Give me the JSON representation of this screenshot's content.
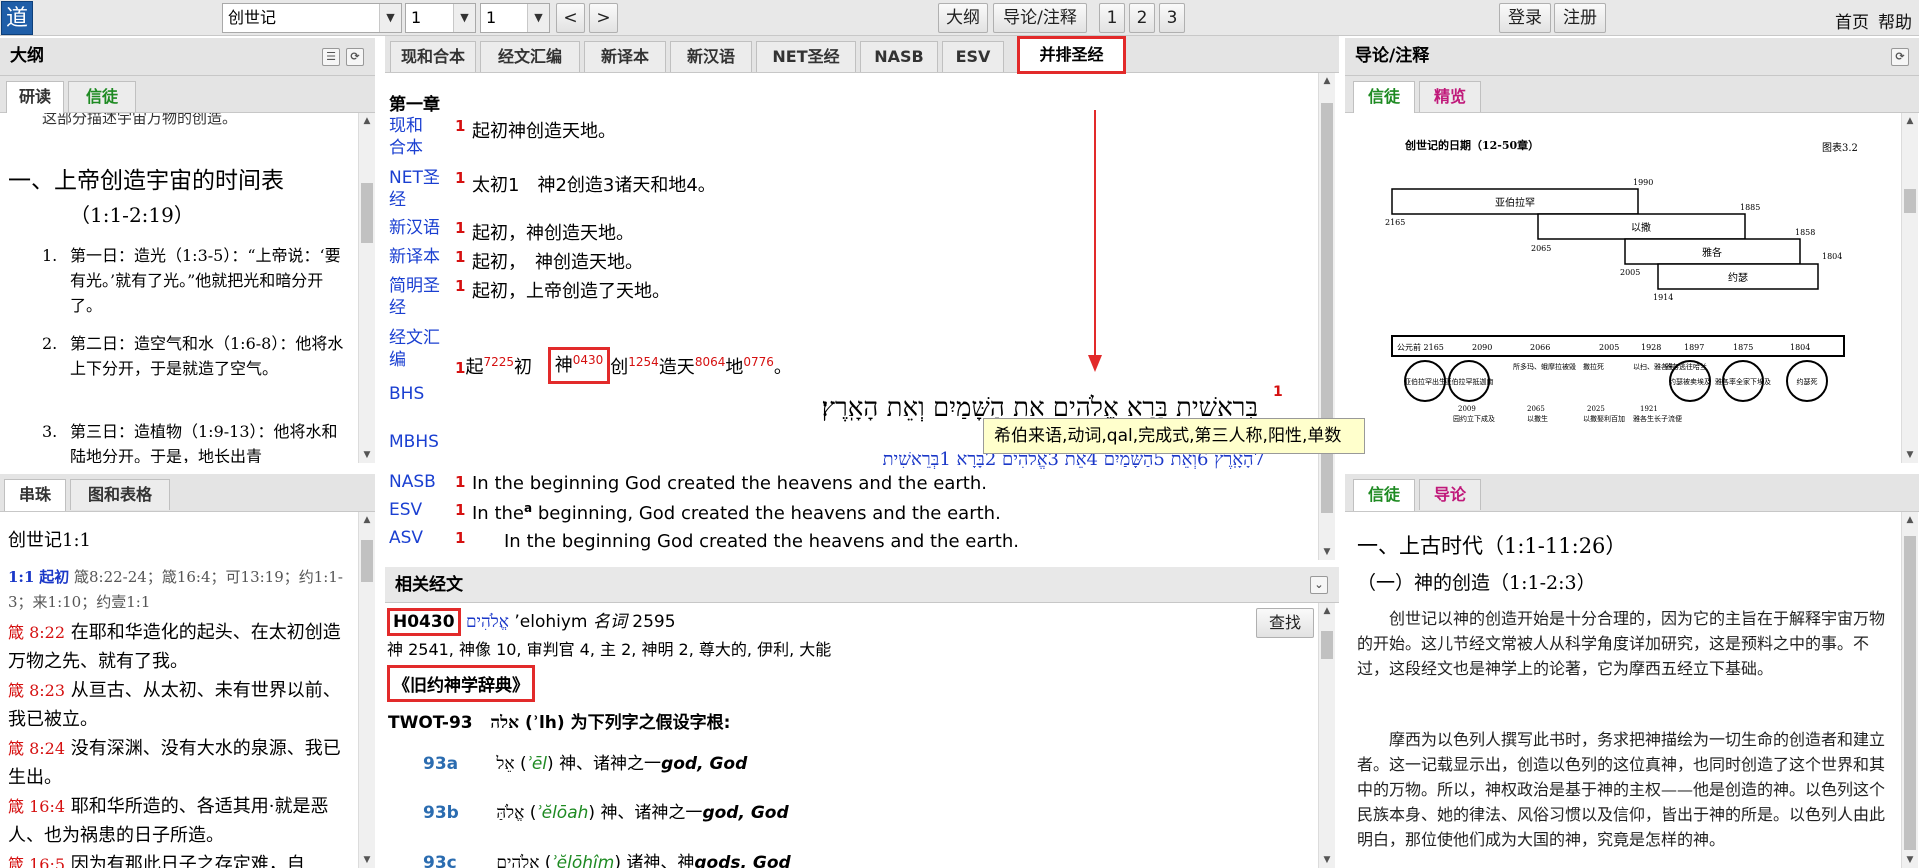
{
  "topbar": {
    "logo": "道",
    "book": "创世记",
    "chapter": "1",
    "verse": "1",
    "prev": "<",
    "next": ">",
    "outline_btn": "大纲",
    "intro_btn": "导论/注释",
    "layout1": "1",
    "layout2": "2",
    "layout3": "3",
    "login": "登录",
    "register": "注册",
    "home": "首页",
    "help": "帮助"
  },
  "left_top": {
    "title": "大纲",
    "tab_study": "研读",
    "tab_xinjing": "信徒",
    "cut_text": "这部分描述宇宙万物的创造。",
    "heading": "一、上帝创造宇宙的时间表",
    "heading_ref": "（1:1-2:19）",
    "items": [
      {
        "num": "1.",
        "text": "第一日：造光（1:3-5）：“上帝说：‘要有光。’就有了光。”他就把光和暗分开了。"
      },
      {
        "num": "2.",
        "text": "第二日：造空气和水（1:6-8）：他将水上下分开，于是就造了空气。"
      },
      {
        "num": "3.",
        "text": "第三日：造植物（1:9-13）：他将水和陆地分开。于是，地长出青"
      }
    ]
  },
  "left_bottom": {
    "tab_chain": "串珠",
    "tab_charts": "图和表格",
    "ref_title": "创世记1:1",
    "first_line": {
      "ref": "1:1",
      "word": "起初",
      "refs": "箴8:22-24；箴16:4；可13:19；约1:1-3；来1:10；约壹1:1"
    },
    "entries": [
      {
        "ref": "箴 8:22",
        "text": "在耶和华造化的起头、在太初创造万物之先、就有了我。"
      },
      {
        "ref": "箴 8:23",
        "text": "从亘古、从太初、未有世界以前、我已被立。"
      },
      {
        "ref": "箴 8:24",
        "text": "没有深渊、没有大水的泉源、我已生出。"
      },
      {
        "ref": "箴 16:4",
        "text": "耶和华所造的、各适其用·就是恶人、也为祸患的日子所造。"
      },
      {
        "ref": "箴 16:5",
        "text": "因为有那此日子之存定难，自"
      }
    ]
  },
  "center": {
    "tabs": [
      "现和合本",
      "经文汇编",
      "新译本",
      "新汉语",
      "NET圣经",
      "NASB",
      "ESV",
      "并排圣经"
    ],
    "chapter": "第一章",
    "verses": [
      {
        "label": "现和合本",
        "num": "1",
        "text": "起初神创造天地。"
      },
      {
        "label": "NET圣经",
        "num": "1",
        "text": "太初1　神2创造3诸天和地4。"
      },
      {
        "label": "新汉语",
        "num": "1",
        "text": "起初，神创造天地。"
      },
      {
        "label": "新译本",
        "num": "1",
        "text": "起初，　神创造天地。"
      },
      {
        "label": "简明圣经",
        "num": "1",
        "text": "起初，上帝创造了天地。"
      }
    ],
    "concord": {
      "label": "经文汇编",
      "num": "1",
      "w1": "起",
      "n1": "7225",
      "w1b": "初",
      "w2": "神",
      "n2": "0430",
      "w3": "创",
      "n3": "1254",
      "w4": "造天",
      "n4": "8064",
      "w5": "地",
      "n5": "0776",
      "end": "。"
    },
    "bhs_label": "BHS",
    "bhs_num": "1",
    "bhs_text": "בְּרֵאשִׁית בָּרָא אֱלֹהִים אֵת הַשָּׁמַיִם וְאֵת הָאָֽרֶץ׃",
    "mbhs_label": "MBHS",
    "mbhs_text": "7הָאָֽרֶץ 6וְאֵת 5הַשָּׁמַיִם 4אֵת 3אֱלֹהִים 2בָּרָא 1בְּרֵאשִׁית",
    "tooltip": "希伯来语,动词,qal,完成式,第三人称,阳性,单数",
    "english": [
      {
        "label": "NASB",
        "num": "1",
        "text": "In the beginning God created the heavens and the earth."
      },
      {
        "label": "ESV",
        "num": "1",
        "text": "In the",
        "sup": "a",
        "text2": "beginning, God created the heavens and the earth."
      },
      {
        "label": "ASV",
        "num": "1",
        "text": "In the beginning God created the heavens and the earth."
      }
    ]
  },
  "related": {
    "title": "相关经文",
    "strong": "H0430",
    "hebrew": "אֱלֹהִים",
    "translit": "’elohiym",
    "pos": "名词",
    "count": "2595",
    "glosses": "神 2541, 神像 10, 审判官 4, 主 2, 神明 2, 尊大的, 伊利, 大能",
    "search_btn": "查找",
    "twot_book": "《旧约神学辞典》",
    "twot_id": "TWOT-93",
    "twot_heb": "אלה",
    "twot_desc": "(ʾlh) 为下列字之假设字根:",
    "twot_items": [
      {
        "id": "93a",
        "heb": "אֵל",
        "tr": "ʾēl",
        "zh": "神、诸神之一",
        "en": "god, God"
      },
      {
        "id": "93b",
        "heb": "אֱלֹהַּ",
        "tr": "ʾĕlōah",
        "zh": "神、诸神之一",
        "en": "god, God"
      },
      {
        "id": "93c",
        "heb": "אֱלֹהִים",
        "tr": "ʾĕlōhîm",
        "zh": "诸神、神",
        "en": "gods, God"
      }
    ]
  },
  "right_top": {
    "title": "导论/注释",
    "tab_xintu": "信徒",
    "tab_jinghua": "精览",
    "chart_title": "创世记的日期（12-50章）",
    "chart_fig": "图表3.2",
    "people": [
      "亚伯拉罕",
      "以撒",
      "雅各",
      "约瑟"
    ],
    "years_top": [
      "1990",
      "1885",
      "1858",
      "1804"
    ],
    "years_left": [
      "2165",
      "2065",
      "2005",
      "1914"
    ],
    "timeline_years": [
      "公元前 2165",
      "2090",
      "2066",
      "2005",
      "1928",
      "1897",
      "1875",
      "1804"
    ],
    "circles": [
      "亚伯拉罕出生",
      "亚伯拉罕抵迦南",
      "约瑟被卖埃及",
      "雅各率全家下埃及",
      "约瑟死"
    ],
    "events": [
      {
        "year": "2066",
        "text": "所多玛、蛾摩拉被毁"
      },
      {
        "year": "2028",
        "text": "撒拉死"
      },
      {
        "year": "",
        "text": "以扫、雅各生"
      },
      {
        "year": "",
        "text": "雅各逃往哈兰"
      },
      {
        "year": "2009",
        "text": "园约立下成及"
      },
      {
        "year": "2065",
        "text": "以撒生"
      },
      {
        "year": "2025",
        "text": "以撒娶利百加"
      },
      {
        "year": "1921",
        "text": "雅各生长子流便"
      }
    ]
  },
  "right_bottom": {
    "tab_xintu": "信徒",
    "tab_intro": "导论",
    "heading": "一、上古时代（1:1-11:26）",
    "sub": "（一）神的创造（1:1-2:3）",
    "para1": "创世记以神的创造开始是十分合理的，因为它的主旨在于解释宇宙万物的开始。这儿节经文常被人从科学角度详加研究，这是预料之中的事。不过，这段经文也是神学上的论著，它为摩西五经立下基础。",
    "para2": "摩西为以色列人撰写此书时，务求把神描绘为一切生命的创造者和建立者。这一记载显示出，创造以色列的这位真神，也同时创造了这个世界和其中的万物。所以，神权政治是基于神的主权——他是创造的神。以色列这个民族本身、她的律法、风俗习惯以及信仰，皆出于神的所是。以色列人由此明白，那位使他们成为大国的神，究竟是怎样的神。"
  },
  "colors": {
    "accent_red": "#e22a2a",
    "link_blue": "#1a3fd1",
    "green": "#1e8a22",
    "magenta": "#c0197a"
  }
}
